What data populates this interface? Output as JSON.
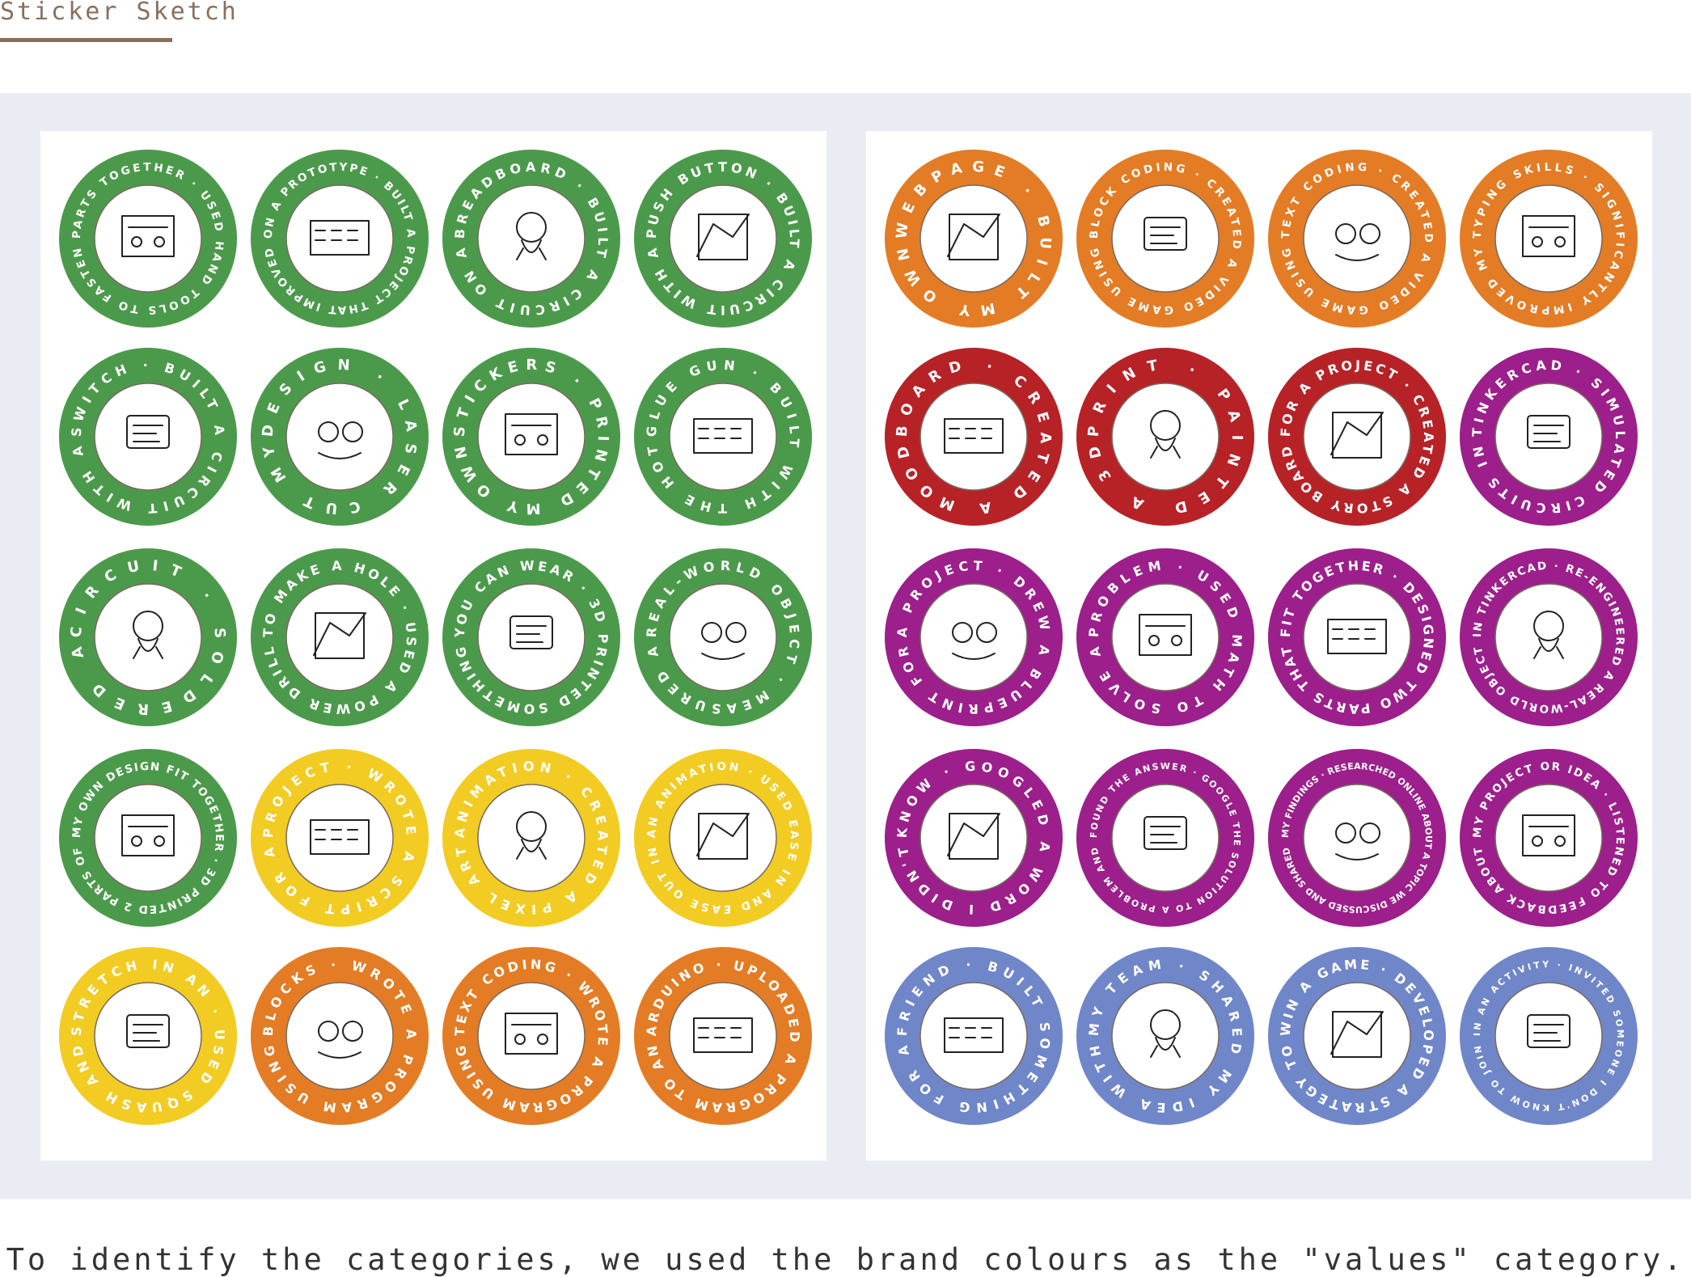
{
  "header": {
    "title": "Sticker Sketch"
  },
  "caption": "To identify the categories, we used the brand colours as the \"values\" category.",
  "colors": {
    "green": "#4b9a4b",
    "yellow": "#f2cc22",
    "orange": "#e37c25",
    "red": "#b72227",
    "purple": "#9c1f8b",
    "periwinkle": "#6f86c9"
  },
  "sheets": [
    {
      "name": "left-sheet",
      "stickers": [
        {
          "color": "green",
          "text": "PARTS TOGETHER · USED HAND TOOLS TO FASTEN",
          "icon": "hand-tools-sketch"
        },
        {
          "color": "green",
          "text": "ON A PROTOTYPE · BUILT A PROJECT THAT IMPROVED",
          "icon": "prototype-sketch"
        },
        {
          "color": "green",
          "text": "BREADBOARD · BUILT A CIRCUIT ON A",
          "icon": "breadboard-sketch"
        },
        {
          "color": "green",
          "text": "PUSH BUTTON · BUILT A CIRCUIT WITH A",
          "icon": "push-button-sketch"
        },
        {
          "color": "green",
          "text": "SWITCH · BUILT A CIRCUIT WITH A",
          "icon": "switch-sketch"
        },
        {
          "color": "green",
          "text": "DESIGN · LASER CUT MY",
          "icon": "laser-cut-sketch"
        },
        {
          "color": "green",
          "text": "STICKERS · PRINTED MY OWN",
          "icon": "stickers-sketch"
        },
        {
          "color": "green",
          "text": "GLUE GUN · BUILT WITH THE HOT",
          "icon": "glue-gun-sketch"
        },
        {
          "color": "green",
          "text": "CIRCUIT · SOLDERED A",
          "icon": "soldering-sketch"
        },
        {
          "color": "green",
          "text": "TO MAKE A HOLE · USED A POWER DRILL",
          "icon": "power-drill-sketch"
        },
        {
          "color": "green",
          "text": "YOU CAN WEAR · 3D PRINTED SOMETHING",
          "icon": "wearable-sketch"
        },
        {
          "color": "green",
          "text": "REAL-WORLD OBJECT · MEASURED A",
          "icon": "measure-sketch"
        },
        {
          "color": "green",
          "text": "MY OWN DESIGN FIT TOGETHER · 3D PRINTED 2 PARTS OF",
          "icon": "puzzle-sketch"
        },
        {
          "color": "yellow",
          "text": "PROJECT · WROTE A SCRIPT FOR A",
          "icon": "script-sketch"
        },
        {
          "color": "yellow",
          "text": "ANIMATION · CREATED A PIXEL ART",
          "icon": "pixel-art-sketch"
        },
        {
          "color": "yellow",
          "text": "AN ANIMATION · USED EASE IN AND EASE OUT IN",
          "icon": "easing-sketch"
        },
        {
          "color": "yellow",
          "text": "STRETCH IN AN · USED SQUASH AND",
          "icon": "squash-stretch-sketch"
        },
        {
          "color": "orange",
          "text": "BLOCKS · WROTE A PROGRAM USING",
          "icon": "blocks-sketch"
        },
        {
          "color": "orange",
          "text": "TEXT CODING · WROTE A PROGRAM USING",
          "icon": "text-coding-sketch"
        },
        {
          "color": "orange",
          "text": "ARDUINO · UPLOADED A PROGRAM TO AN",
          "icon": "arduino-sketch"
        }
      ]
    },
    {
      "name": "right-sheet",
      "stickers": [
        {
          "color": "orange",
          "text": "WEBPAGE · BUILT MY OWN",
          "icon": "webpage-sketch"
        },
        {
          "color": "orange",
          "text": "BLOCK CODING · CREATED A VIDEO GAME USING",
          "icon": "maze-sketch"
        },
        {
          "color": "orange",
          "text": "TEXT CODING · CREATED A VIDEO GAME USING",
          "icon": "game-sketch"
        },
        {
          "color": "orange",
          "text": "TYPING SKILLS · SIGNIFICANTLY IMPROVED MY",
          "icon": "typing-sketch"
        },
        {
          "color": "red",
          "text": "BOARD · CREATED A MOOD",
          "icon": "mood-board-sketch"
        },
        {
          "color": "red",
          "text": "PRINT · PAINTED A 3D",
          "icon": "painting-sketch"
        },
        {
          "color": "red",
          "text": "FOR A PROJECT · CREATED A STORY BOARD",
          "icon": "storyboard-sketch"
        },
        {
          "color": "purple",
          "text": "TINKERCAD · SIMULATED CIRCUITS IN",
          "icon": "tinkercad-sketch"
        },
        {
          "color": "purple",
          "text": "A PROJECT · DREW A BLUEPRINT FOR",
          "icon": "blueprint-sketch"
        },
        {
          "color": "purple",
          "text": "PROBLEM · USED MATH TO SOLVE A",
          "icon": "math-sketch"
        },
        {
          "color": "purple",
          "text": "FIT TOGETHER · DESIGNED TWO PARTS THAT",
          "icon": "gears-sketch"
        },
        {
          "color": "purple",
          "text": "IN TINKERCAD · RE-ENGINEERED A REAL-WORLD OBJECT",
          "icon": "re-engineer-sketch"
        },
        {
          "color": "purple",
          "text": "KNOW · GOOGLED A WORD I DIDN'T",
          "icon": "google-sketch"
        },
        {
          "color": "purple",
          "text": "FOUND THE ANSWER · GOOGLE THE SOLUTION TO A PROBLEM AND",
          "icon": "google-answer-sketch"
        },
        {
          "color": "purple",
          "text": "MY FINDINGS · RESEARCHED ONLINE ABOUT A TOPIC WE DISCUSSED AND SHARED",
          "icon": "research-sketch"
        },
        {
          "color": "purple",
          "text": "MY PROJECT OR IDEA · LISTENED TO FEEDBACK ABOUT",
          "icon": "feedback-sketch"
        },
        {
          "color": "periwinkle",
          "text": "FRIEND · BUILT SOMETHING FOR A",
          "icon": "friend-sketch"
        },
        {
          "color": "periwinkle",
          "text": "MY TEAM · SHARED MY IDEA WITH",
          "icon": "team-sketch"
        },
        {
          "color": "periwinkle",
          "text": "WIN A GAME · DEVELOPED A STRATEGY TO",
          "icon": "strategy-sketch"
        },
        {
          "color": "periwinkle",
          "text": "IN AN ACTIVITY · INVITED SOMEONE I DON'T KNOW TO JOIN",
          "icon": "invite-sketch"
        }
      ]
    }
  ]
}
